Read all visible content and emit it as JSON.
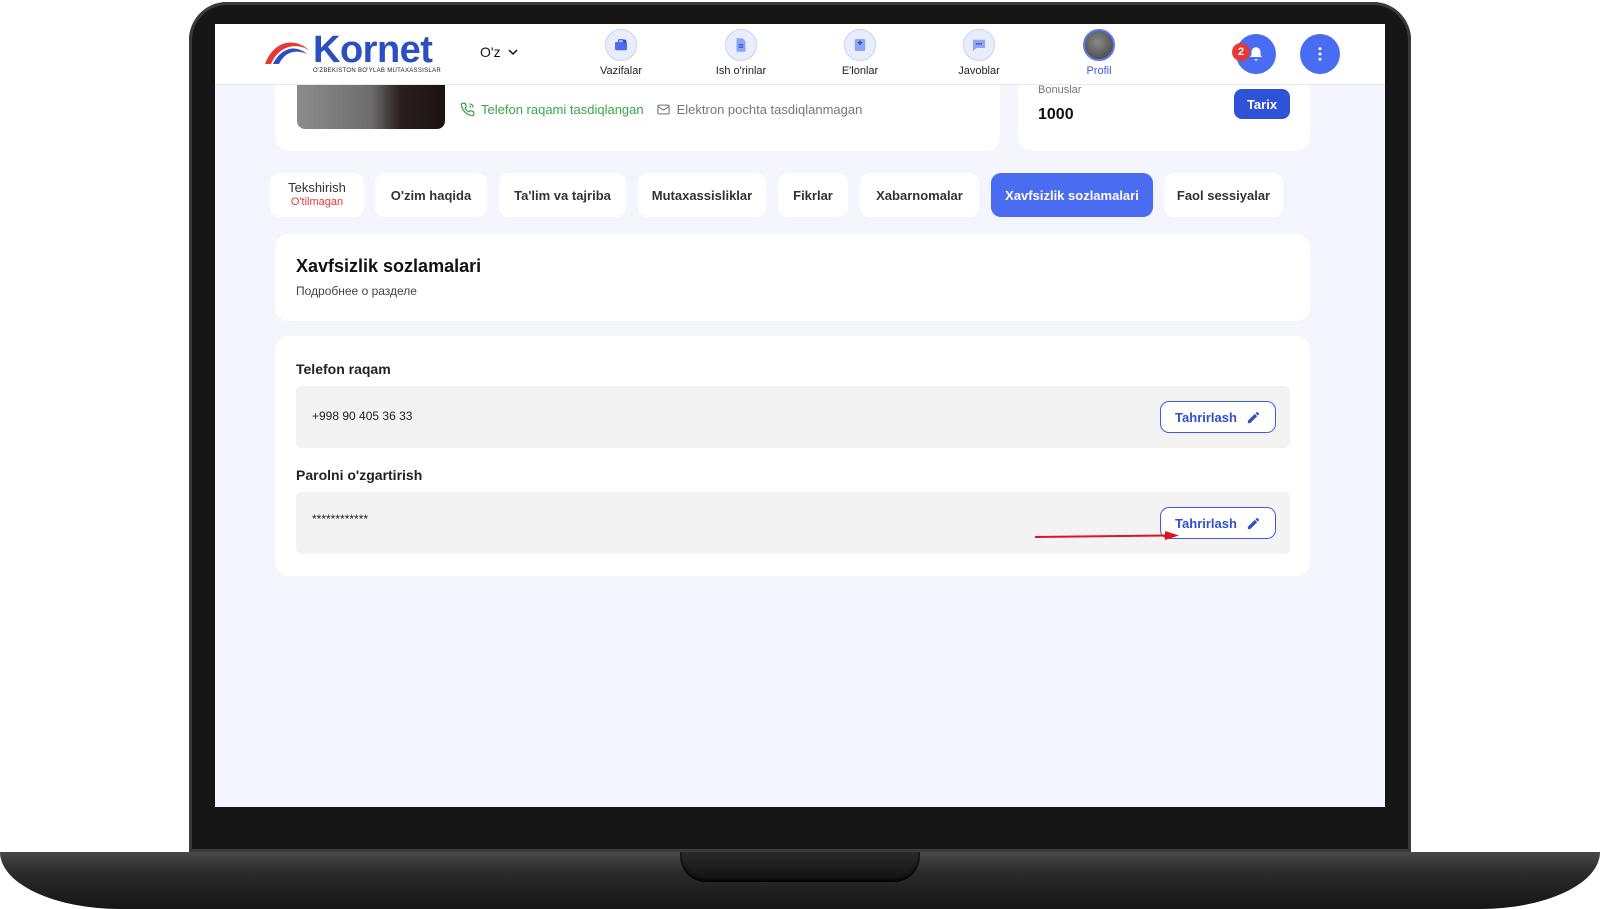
{
  "header": {
    "logo_text": "Kornet",
    "logo_tagline": "O'ZBEKISTON BO'YLAB MUTAXASSISLAR",
    "language": "O'z",
    "nav": [
      {
        "label": "Vazifalar",
        "icon": "briefcase-icon"
      },
      {
        "label": "Ish o'rinlar",
        "icon": "document-icon"
      },
      {
        "label": "E'lonlar",
        "icon": "announcement-icon"
      },
      {
        "label": "Javoblar",
        "icon": "chat-icon"
      },
      {
        "label": "Profil",
        "icon": "avatar-icon",
        "active": true
      }
    ],
    "notifications_count": "2"
  },
  "profile": {
    "phone_verified": "Telefon raqami tasdiqlangan",
    "email_status": "Elektron pochta tasdiqlanmagan",
    "bonus_label": "Bonuslar",
    "bonus_value": "1000",
    "history_button": "Tarix"
  },
  "tabs": [
    {
      "label": "Tekshirish",
      "sub": "O'tilmagan"
    },
    {
      "label": "O'zim haqida"
    },
    {
      "label": "Ta'lim va tajriba"
    },
    {
      "label": "Mutaxassisliklar"
    },
    {
      "label": "Fikrlar"
    },
    {
      "label": "Xabarnomalar"
    },
    {
      "label": "Xavfsizlik sozlamalari",
      "active": true
    },
    {
      "label": "Faol sessiyalar"
    }
  ],
  "section": {
    "title": "Xavfsizlik sozlamalari",
    "subtitle": "Подробнее о разделе"
  },
  "fields": {
    "phone": {
      "label": "Telefon raqam",
      "value": "+998 90 405 36 33",
      "button": "Tahrirlash"
    },
    "password": {
      "label": "Parolni o'zgartirish",
      "value": "************",
      "button": "Tahrirlash"
    }
  },
  "colors": {
    "accent": "#4a6cf0",
    "accent_dark": "#2f53d6",
    "success": "#3aa54a",
    "danger": "#e53935",
    "page_bg": "#f5f6fd"
  }
}
